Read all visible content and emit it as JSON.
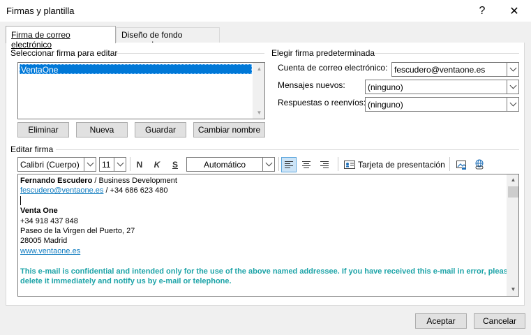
{
  "window": {
    "title": "Firmas y plantilla",
    "help": "?",
    "close": "✕"
  },
  "tabs": [
    {
      "label": "Firma de correo electrónico",
      "active": true
    },
    {
      "label": "Diseño de fondo personal",
      "active": false
    }
  ],
  "select_signature": {
    "heading": "Seleccionar firma para editar",
    "items": [
      "VentaOne"
    ],
    "buttons": {
      "delete": "Eliminar",
      "new": "Nueva",
      "save": "Guardar",
      "rename": "Cambiar nombre"
    }
  },
  "default_signature": {
    "heading": "Elegir firma predeterminada",
    "account_label": "Cuenta de correo electrónico:",
    "account_value": "fescudero@ventaone.es",
    "new_label": "Mensajes nuevos:",
    "new_value": "(ninguno)",
    "reply_label": "Respuestas o reenvíos:",
    "reply_value": "(ninguno)"
  },
  "editor": {
    "heading": "Editar firma",
    "font": "Calibri (Cuerpo)",
    "size": "11",
    "bold": "N",
    "italic": "K",
    "underline": "S",
    "color": "Automático",
    "business_card": "Tarjeta de presentación",
    "content": {
      "name": "Fernando Escudero",
      "role": " / Business Development",
      "email": "fescudero@ventaone.es",
      "phone": " / +34 686 623 480",
      "company": "Venta One",
      "company_phone": "+34 918 437 848",
      "address1": "Paseo de la Virgen del Puerto, 27",
      "address2": "28005 Madrid",
      "website": "www.ventaone.es",
      "disclaimer1": "This e-mail is confidential and intended only for the use of the above named addressee. If you have received this e-mail in error, please",
      "disclaimer2": "delete it immediately and notify us by e-mail or telephone."
    }
  },
  "footer": {
    "ok": "Aceptar",
    "cancel": "Cancelar"
  },
  "colors": {
    "selection": "#0078d7",
    "link": "#0f7bbf",
    "disclaimer": "#1ea4a8"
  }
}
